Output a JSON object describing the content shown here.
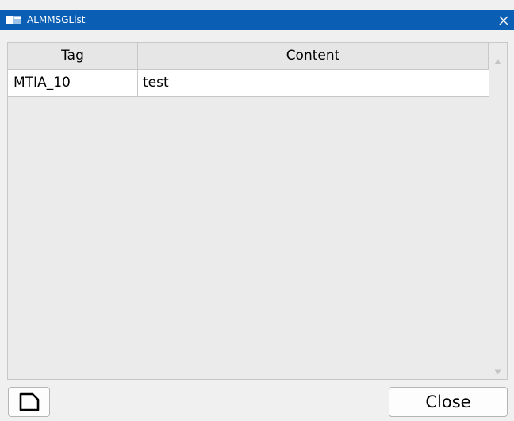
{
  "window": {
    "title": "ALMMSGList",
    "accent_color": "#0a5fb4"
  },
  "table": {
    "columns": [
      "Tag",
      "Content"
    ],
    "rows": [
      {
        "tag": "MTIA_10",
        "content": "test"
      }
    ]
  },
  "footer": {
    "close_label": "Close"
  },
  "icons": {
    "app": "window-app-icon",
    "titlebar_close": "close-icon",
    "new": "new-document-icon",
    "scroll_up": "arrow-up-icon",
    "scroll_down": "arrow-down-icon"
  }
}
